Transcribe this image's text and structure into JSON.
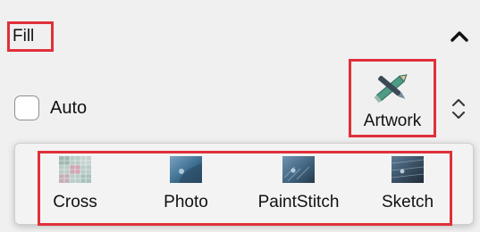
{
  "fill": {
    "title": "Fill",
    "auto_label": "Auto",
    "auto_checked": false,
    "artwork_label": "Artwork"
  },
  "dropdown": {
    "options": [
      {
        "label": "Cross",
        "icon": "cross-stitch-thumbnail-icon"
      },
      {
        "label": "Photo",
        "icon": "photo-thumbnail-icon"
      },
      {
        "label": "PaintStitch",
        "icon": "paintstitch-thumbnail-icon"
      },
      {
        "label": "Sketch",
        "icon": "sketch-thumbnail-icon"
      }
    ]
  },
  "colors": {
    "highlight": "#e0303a",
    "panel_bg": "#f0f0f0"
  }
}
